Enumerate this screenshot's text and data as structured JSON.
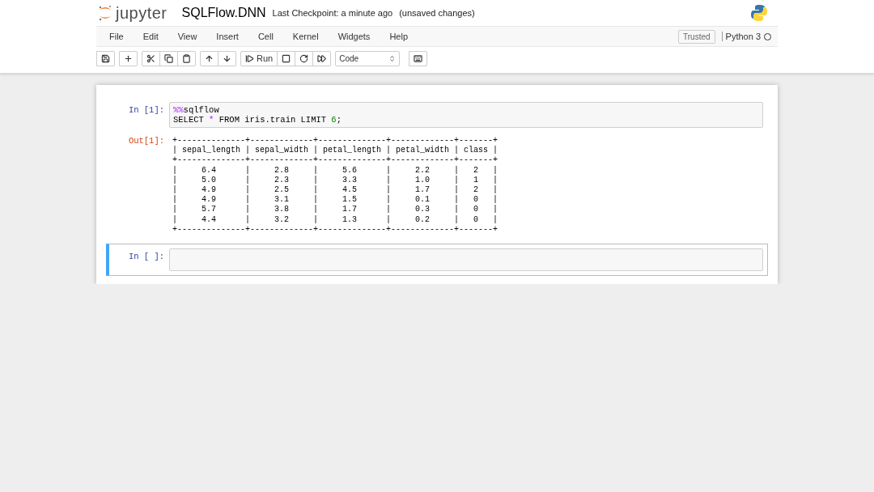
{
  "header": {
    "logo_text": "jupyter",
    "notebook_name": "SQLFlow.DNN",
    "checkpoint": "Last Checkpoint: a minute ago",
    "save_status": "(unsaved changes)"
  },
  "menu": [
    "File",
    "Edit",
    "View",
    "Insert",
    "Cell",
    "Kernel",
    "Widgets",
    "Help"
  ],
  "trusted": "Trusted",
  "kernel": {
    "name": "Python 3",
    "busy": false
  },
  "toolbar": {
    "run_label": "Run",
    "cell_type": "Code"
  },
  "cells": [
    {
      "prompt": "In [1]:",
      "selected": false,
      "lines": [
        [
          {
            "kind": "magic",
            "text": "%%"
          },
          {
            "kind": "plain",
            "text": "sqlflow"
          }
        ],
        [
          {
            "kind": "plain",
            "text": "SELECT "
          },
          {
            "kind": "operator",
            "text": "*"
          },
          {
            "kind": "plain",
            "text": " FROM iris.train LIMIT "
          },
          {
            "kind": "number",
            "text": "6"
          },
          {
            "kind": "plain",
            "text": ";"
          }
        ]
      ],
      "output": {
        "prompt": "Out[1]:",
        "lines": [
          "+--------------+-------------+--------------+-------------+-------+",
          "| sepal_length | sepal_width | petal_length | petal_width | class |",
          "+--------------+-------------+--------------+-------------+-------+",
          "|     6.4      |     2.8     |     5.6      |     2.2     |   2   |",
          "|     5.0      |     2.3     |     3.3      |     1.0     |   1   |",
          "|     4.9      |     2.5     |     4.5      |     1.7     |   2   |",
          "|     4.9      |     3.1     |     1.5      |     0.1     |   0   |",
          "|     5.7      |     3.8     |     1.7      |     0.3     |   0   |",
          "|     4.4      |     3.2     |     1.3      |     0.2     |   0   |",
          "+--------------+-------------+--------------+-------------+-------+"
        ]
      }
    },
    {
      "prompt": "In [ ]:",
      "selected": true
    }
  ]
}
